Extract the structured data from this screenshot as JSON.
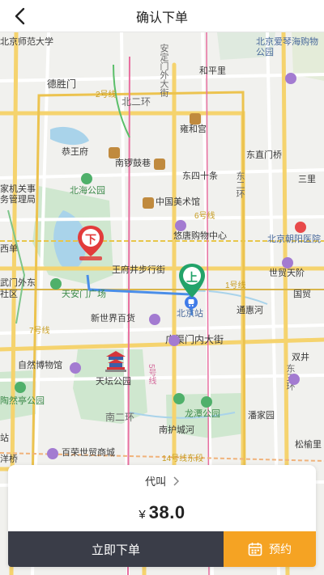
{
  "header": {
    "title": "确认下单"
  },
  "map": {
    "labels": {
      "bnu": "北京师范大学",
      "deshengmen": "德胜门",
      "line2": "2号线",
      "north_ring": "北二环",
      "andingmen_st": "安定门外大街",
      "hepingli": "和平里",
      "aiqinhai": "北京爱琴海购物公园",
      "yonghegong": "雍和宫",
      "gongwangfu": "恭王府",
      "dongzhimen": "东直门桥",
      "nanluoguxiang": "南锣鼓巷",
      "dongsishi": "东四十条",
      "sanli": "三里",
      "mofcom": "家机关事务管理局",
      "beihai": "北海公园",
      "art_museum": "中国美术馆",
      "line6": "6号线",
      "second_ring_east": "东二环",
      "chaoyang_hosp": "北京朝阳医院",
      "youtang": "悠唐购物中心",
      "xidan": "西单",
      "wangfujing": "王府井步行街",
      "shimao": "世贸天阶",
      "guomao": "国贸",
      "xuanwumen": "武门外东",
      "tiananmen": "天安门广场",
      "line1": "1号线",
      "beijing_station": "北京站",
      "tonghui": "通惠河",
      "shequ": "社区",
      "xinshijie": "新世界百货",
      "line7": "7号线",
      "guangqumen": "广渠门内大街",
      "shuangjing": "双井",
      "natural_museum": "自然博物馆",
      "tiantan": "天坛公园",
      "east_third": "东三环",
      "line5": "5号线",
      "longtan": "龙潭公园",
      "taoranting": "陶然亭公园",
      "south_ring": "南二环",
      "panjiayuan": "潘家园",
      "nanhu": "南护城河",
      "songyu": "松榆里",
      "zhan": "站",
      "bairong": "百荣世贸商城",
      "line14": "14号线东段",
      "yangqiao": "洋桥"
    },
    "pins": {
      "dropoff": "下",
      "pickup": "上"
    }
  },
  "panel": {
    "call_label": "代叫",
    "currency": "¥",
    "price": "38.0",
    "order_button": "立即下单",
    "reserve_button": "预约"
  },
  "colors": {
    "accent": "#f5a323",
    "dark_button": "#3a3d48",
    "pickup_pin": "#23a36a",
    "dropoff_pin": "#e23b3b"
  }
}
